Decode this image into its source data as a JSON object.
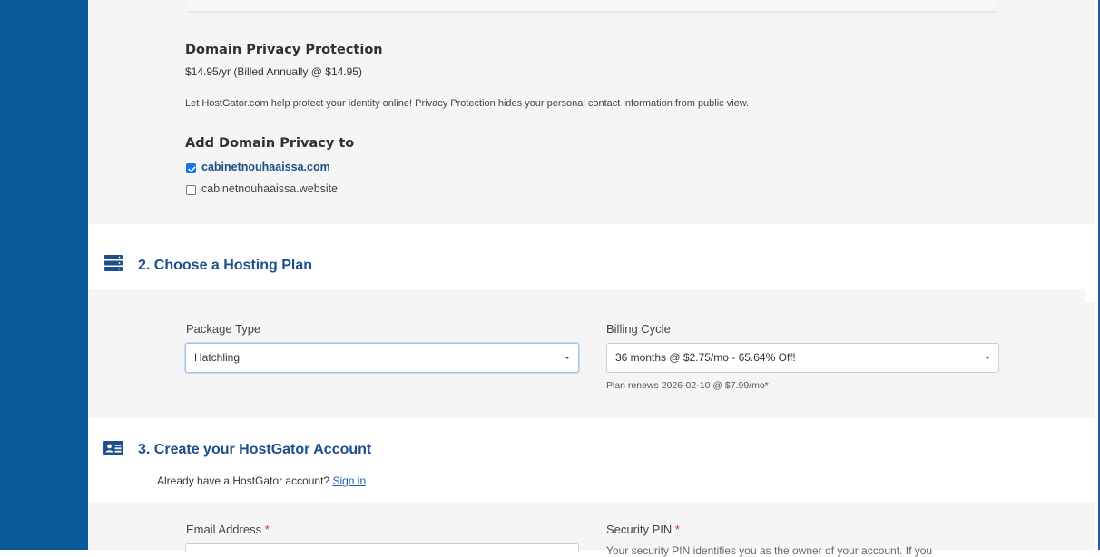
{
  "privacy": {
    "title": "Domain Privacy Protection",
    "price": "$14.95/yr (Billed Annually @ $14.95)",
    "description": "Let HostGator.com help protect your identity online! Privacy Protection hides your personal contact information from public view.",
    "add_to_label": "Add Domain Privacy to",
    "domains": [
      {
        "name": "cabinetnouhaaissa.com",
        "checked": true
      },
      {
        "name": "cabinetnouhaaissa.website",
        "checked": false
      }
    ]
  },
  "hosting": {
    "title": "2. Choose a Hosting Plan",
    "icon": "server-icon",
    "package_label": "Package Type",
    "package_value": "Hatchling",
    "billing_label": "Billing Cycle",
    "billing_value": "36 months @ $2.75/mo - 65.64% Off!",
    "renew_note": "Plan renews 2026-02-10 @ $7.99/mo*"
  },
  "account": {
    "title": "3. Create your HostGator Account",
    "icon": "id-card-icon",
    "existing_text": "Already have a HostGator account?",
    "sign_in_label": "Sign in",
    "email_label": "Email Address",
    "pin_label": "Security PIN",
    "required_mark": "*",
    "pin_help_partial": "Your security PIN identifies you as the owner of your account. If you"
  },
  "colors": {
    "sidebar": "#0a5a9c",
    "heading_blue": "#1d4f8a",
    "checkbox_blue": "#1a73e8",
    "required_red": "#d9302c"
  }
}
